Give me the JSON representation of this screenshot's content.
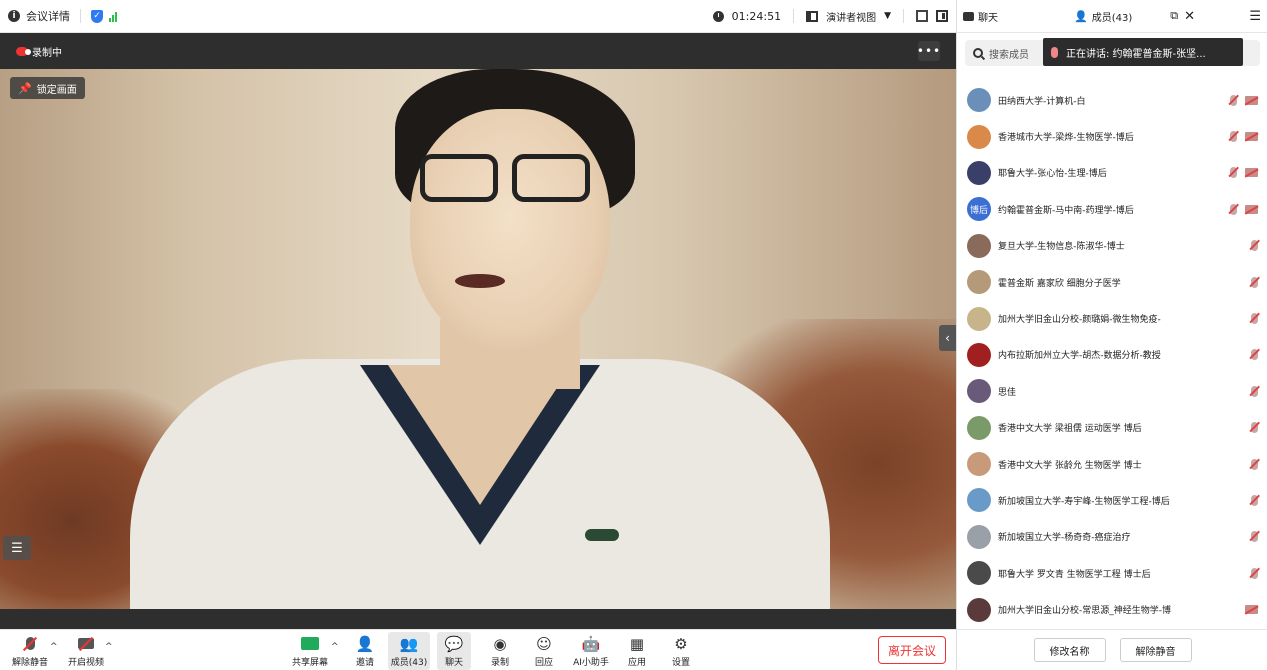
{
  "topbar": {
    "meeting_info_label": "会议详情",
    "timer": "01:24:51",
    "view_mode_label": "演讲者视图"
  },
  "video": {
    "recording_label": "录制中",
    "more_label": "•••",
    "lock_label": "锁定画面"
  },
  "toolbar": {
    "unmute_label": "解除静音",
    "start_video_label": "开启视频",
    "share_label": "共享屏幕",
    "invite_label": "邀请",
    "members_label": "成员(43)",
    "chat_label": "聊天",
    "record_label": "录制",
    "react_label": "回应",
    "ai_label": "AI小助手",
    "apps_label": "应用",
    "settings_label": "设置",
    "leave_label": "离开会议"
  },
  "panel": {
    "chat_tab": "聊天",
    "members_tab": "成员(43)",
    "search_placeholder": "搜索成员",
    "speaking_text": "正在讲话: 约翰霍普金斯-张坚...",
    "members": [
      {
        "name": "田纳西大学-计算机-白",
        "mic_muted": true,
        "cam_off": true,
        "avatar_color": "#6a8fb8"
      },
      {
        "name": "香港城市大学-梁烨-生物医学-博后",
        "mic_muted": true,
        "cam_off": true,
        "avatar_color": "#d98a4a"
      },
      {
        "name": "耶鲁大学-张心怡-生理-博后",
        "mic_muted": true,
        "cam_off": true,
        "avatar_color": "#3a3f6a"
      },
      {
        "name": "约翰霍普金斯-马中南-药理学-博后",
        "mic_muted": true,
        "cam_off": true,
        "avatar_color": "#3b6fd4",
        "avatar_text": "博后"
      },
      {
        "name": "复旦大学-生物信息-陈淑华-博士",
        "mic_muted": true,
        "cam_off": false,
        "avatar_color": "#8a6a5a"
      },
      {
        "name": "霍普金斯 嘉家欣 细胞分子医学",
        "mic_muted": true,
        "cam_off": false,
        "avatar_color": "#b59a7a"
      },
      {
        "name": "加州大学旧金山分校-颜璐娟-微生物免疫-",
        "mic_muted": true,
        "cam_off": false,
        "avatar_color": "#c8b48a"
      },
      {
        "name": "内布拉斯加州立大学-胡杰-数据分析-教授",
        "mic_muted": true,
        "cam_off": false,
        "avatar_color": "#a02020"
      },
      {
        "name": "思佳",
        "mic_muted": true,
        "cam_off": false,
        "avatar_color": "#6a5a7a"
      },
      {
        "name": "香港中文大学 梁祖儒 运动医学 博后",
        "mic_muted": true,
        "cam_off": false,
        "avatar_color": "#7a9a6a"
      },
      {
        "name": "香港中文大学 张龄允 生物医学 博士",
        "mic_muted": true,
        "cam_off": false,
        "avatar_color": "#c89a7a"
      },
      {
        "name": "新加坡国立大学-寿宇峰-生物医学工程-博后",
        "mic_muted": true,
        "cam_off": false,
        "avatar_color": "#6a9ac8"
      },
      {
        "name": "新加坡国立大学-杨奇奇-癌症治疗",
        "mic_muted": true,
        "cam_off": false,
        "avatar_color": "#9aa0a8"
      },
      {
        "name": "耶鲁大学 罗文青 生物医学工程 博士后",
        "mic_muted": true,
        "cam_off": false,
        "avatar_color": "#4a4a4a"
      },
      {
        "name": "加州大学旧金山分校-常思源_神经生物学-博",
        "mic_muted": false,
        "cam_off": true,
        "avatar_color": "#5a3a3a"
      }
    ],
    "rename_label": "修改名称",
    "unmute_label": "解除静音"
  },
  "colors": {
    "accent_blue": "#2f7af3",
    "leave_red": "#e33333",
    "signal_green": "#2fbf4c",
    "share_green": "#1faa5c"
  }
}
